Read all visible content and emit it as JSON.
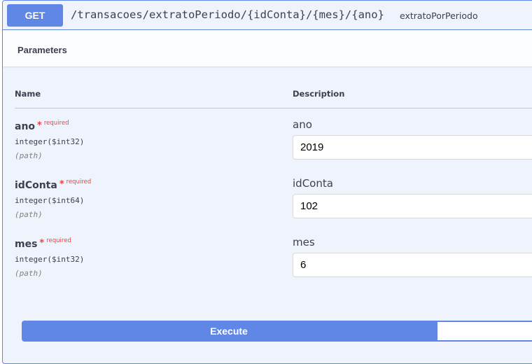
{
  "operation": {
    "method": "GET",
    "path": "/transacoes/extratoPeriodo/{idConta}/{mes}/{ano}",
    "operation_id": "extratoPorPeriodo"
  },
  "parameters_section": {
    "title": "Parameters",
    "col_name": "Name",
    "col_description": "Description",
    "required_star": "*",
    "required_text": "required",
    "params": [
      {
        "name": "ano",
        "type": "integer($int32)",
        "in": "(path)",
        "description": "ano",
        "value": "2019"
      },
      {
        "name": "idConta",
        "type": "integer($int64)",
        "in": "(path)",
        "description": "idConta",
        "value": "102"
      },
      {
        "name": "mes",
        "type": "integer($int32)",
        "in": "(path)",
        "description": "mes",
        "value": "6"
      }
    ]
  },
  "actions": {
    "execute_label": "Execute"
  },
  "colors": {
    "get_accent": "#6187e6",
    "block_background": "#eff3fb",
    "required": "#ff3a3a",
    "text": "#3b4151"
  }
}
